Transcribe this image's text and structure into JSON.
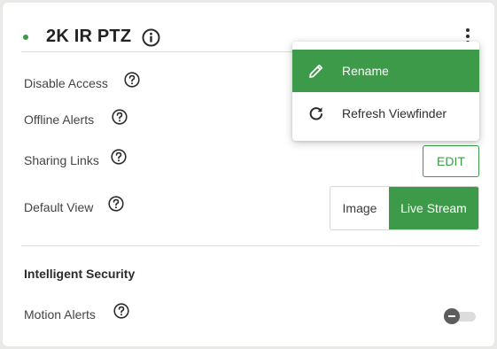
{
  "camera": {
    "title": "2K IR PTZ",
    "status_color": "#3d9a48"
  },
  "icons": {
    "info": "info-circle-icon",
    "menu": "kebab-menu-icon",
    "help": "question-circle-icon",
    "rename": "pencil-icon",
    "refresh": "refresh-icon"
  },
  "colors": {
    "accent": "#3d9a48",
    "background": "#e9e9e7",
    "card": "#ffffff"
  },
  "settings": {
    "disable_access": {
      "label": "Disable Access"
    },
    "offline_alerts": {
      "label": "Offline Alerts"
    },
    "sharing_links": {
      "label": "Sharing Links",
      "button": "EDIT"
    },
    "default_view": {
      "label": "Default View",
      "options": [
        "Image",
        "Live Stream"
      ],
      "selected": "Live Stream"
    }
  },
  "intelligent_security": {
    "title": "Intelligent Security",
    "motion_alerts": {
      "label": "Motion Alerts",
      "enabled": false
    }
  },
  "context_menu": {
    "items": [
      {
        "label": "Rename",
        "icon": "pencil-icon",
        "highlighted": true
      },
      {
        "label": "Refresh Viewfinder",
        "icon": "refresh-icon",
        "highlighted": false
      }
    ]
  }
}
